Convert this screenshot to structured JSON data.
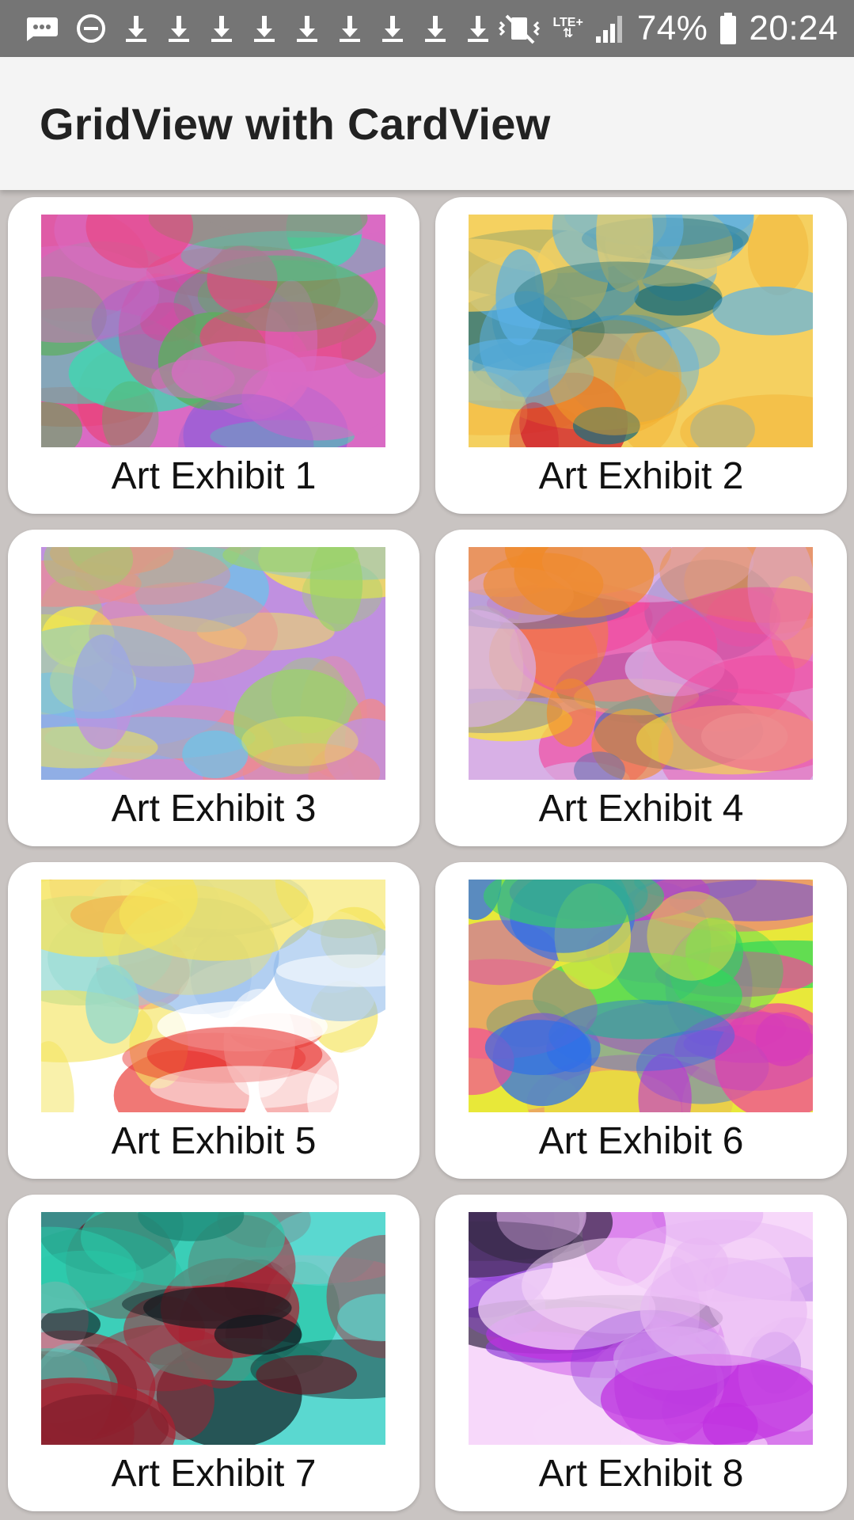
{
  "status_bar": {
    "network_label": "LTE+",
    "battery": "74%",
    "time": "20:24",
    "icons": [
      "message-icon",
      "do-not-disturb-icon",
      "download-icon",
      "download-icon",
      "download-icon",
      "download-icon",
      "download-icon",
      "download-icon",
      "download-icon",
      "download-icon",
      "download-icon",
      "vibrate-icon",
      "signal-icon",
      "battery-icon"
    ]
  },
  "app_bar": {
    "title": "GridView with CardView"
  },
  "grid": {
    "items": [
      {
        "label": "Art Exhibit 1",
        "colors": [
          "#9b5fd6",
          "#e8457f",
          "#5ab05a",
          "#3ed8b0",
          "#d96bc4"
        ]
      },
      {
        "label": "Art Exhibit 2",
        "colors": [
          "#f2a928",
          "#d1232f",
          "#1f6f7a",
          "#5bb2e6",
          "#f5d060"
        ]
      },
      {
        "label": "Art Exhibit 3",
        "colors": [
          "#f7e94c",
          "#6fc3e8",
          "#f08a8a",
          "#9bd36a",
          "#c090e0"
        ]
      },
      {
        "label": "Art Exhibit 4",
        "colors": [
          "#f04aa0",
          "#f7e33b",
          "#f08a2a",
          "#5a6fb0",
          "#d8b0e6"
        ]
      },
      {
        "label": "Art Exhibit 5",
        "colors": [
          "#8fd8d0",
          "#f4e35a",
          "#8db8ea",
          "#e8322e",
          "#ffffff"
        ]
      },
      {
        "label": "Art Exhibit 6",
        "colors": [
          "#c030d8",
          "#2f6fe8",
          "#30d85a",
          "#f04a9a",
          "#e8e83a"
        ]
      },
      {
        "label": "Art Exhibit 7",
        "colors": [
          "#0f1a1f",
          "#28c8a8",
          "#e8a0b8",
          "#a82030",
          "#5ad8d0"
        ]
      },
      {
        "label": "Art Exhibit 8",
        "colors": [
          "#e8b8f4",
          "#c030e0",
          "#8f40d8",
          "#3a2a4a",
          "#f7d8fa"
        ]
      }
    ]
  }
}
